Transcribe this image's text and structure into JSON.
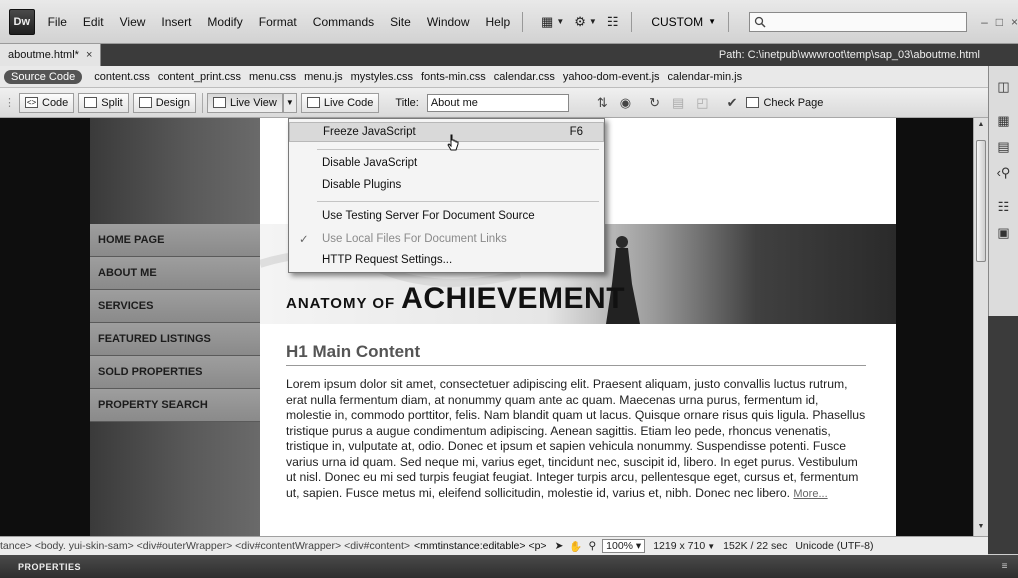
{
  "app": {
    "logo": "Dw"
  },
  "menu": [
    "File",
    "Edit",
    "View",
    "Insert",
    "Modify",
    "Format",
    "Commands",
    "Site",
    "Window",
    "Help"
  ],
  "workspace": {
    "label": "CUSTOM"
  },
  "search": {
    "placeholder": ""
  },
  "document": {
    "tab_label": "aboutme.html*",
    "path": "Path:  C:\\inetpub\\wwwroot\\temp\\sap_03\\aboutme.html"
  },
  "related_files": {
    "source_label": "Source Code",
    "files": [
      "content.css",
      "content_print.css",
      "menu.css",
      "menu.js",
      "mystyles.css",
      "fonts-min.css",
      "calendar.css",
      "yahoo-dom-event.js",
      "calendar-min.js"
    ]
  },
  "doc_toolbar": {
    "code": "Code",
    "split": "Split",
    "design": "Design",
    "live_view": "Live View",
    "live_code": "Live Code",
    "title_label": "Title:",
    "title_value": "About me",
    "check_page": "Check Page"
  },
  "live_view_menu": {
    "items": [
      {
        "label": "Freeze JavaScript",
        "shortcut": "F6"
      },
      {
        "label": "Disable JavaScript"
      },
      {
        "label": "Disable Plugins"
      },
      {
        "label": "Use Testing Server For Document Source"
      },
      {
        "label": "Use Local Files For Document Links",
        "checked": true
      },
      {
        "label": "HTTP Request Settings..."
      }
    ]
  },
  "site": {
    "nav": [
      "HOME PAGE",
      "ABOUT ME",
      "SERVICES",
      "FEATURED LISTINGS",
      "SOLD PROPERTIES",
      "PROPERTY SEARCH"
    ],
    "banner_small": "ANATOMY OF",
    "banner_big": "ACHIEVEMENT",
    "heading": "H1 Main Content",
    "body": "Lorem ipsum dolor sit amet, consectetuer adipiscing elit. Praesent aliquam, justo convallis luctus rutrum, erat nulla fermentum diam, at nonummy quam ante ac quam. Maecenas urna purus, fermentum id, molestie in, commodo porttitor, felis. Nam blandit quam ut lacus. Quisque ornare risus quis ligula. Phasellus tristique purus a augue condimentum adipiscing. Aenean sagittis. Etiam leo pede, rhoncus venenatis, tristique in, vulputate at, odio. Donec et ipsum et sapien vehicula nonummy. Suspendisse potenti. Fusce varius urna id quam. Sed neque mi, varius eget, tincidunt nec, suscipit id, libero. In eget purus. Vestibulum ut nisl. Donec eu mi sed turpis feugiat feugiat. Integer turpis arcu, pellentesque eget, cursus et, fermentum ut, sapien. Fusce metus mi, eleifend sollicitudin, molestie id, varius et, nibh. Donec nec libero.",
    "more": "More..."
  },
  "status_bar": {
    "tags": "tance> <body. yui-skin-sam> <div#outerWrapper> <div#contentWrapper> <div#content>",
    "current_tag": "<mmtinstance:editable> <p>",
    "zoom": "100%",
    "size": "1219 x 710",
    "download": "152K / 22 sec",
    "encoding": "Unicode (UTF-8)"
  },
  "properties": {
    "label": "PROPERTIES"
  }
}
